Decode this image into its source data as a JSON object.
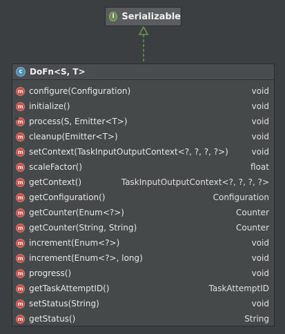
{
  "interface": {
    "badge": "I",
    "name": "Serializable"
  },
  "class": {
    "badge": "c",
    "name": "DoFn<S, T>",
    "members": [
      {
        "name": "configure(Configuration)",
        "type": "void",
        "abstract": false
      },
      {
        "name": "initialize()",
        "type": "void",
        "abstract": false
      },
      {
        "name": "process(S, Emitter<T>)",
        "type": "void",
        "abstract": true
      },
      {
        "name": "cleanup(Emitter<T>)",
        "type": "void",
        "abstract": false
      },
      {
        "name": "setContext(TaskInputOutputContext<?, ?, ?, ?>)",
        "type": "void",
        "abstract": false
      },
      {
        "name": "scaleFactor()",
        "type": "float",
        "abstract": false
      },
      {
        "name": "getContext()",
        "type": "TaskInputOutputContext<?, ?, ?, ?>",
        "abstract": false
      },
      {
        "name": "getConfiguration()",
        "type": "Configuration",
        "abstract": false
      },
      {
        "name": "getCounter(Enum<?>)",
        "type": "Counter",
        "abstract": false
      },
      {
        "name": "getCounter(String, String)",
        "type": "Counter",
        "abstract": false
      },
      {
        "name": "increment(Enum<?>)",
        "type": "void",
        "abstract": false
      },
      {
        "name": "increment(Enum<?>, long)",
        "type": "void",
        "abstract": false
      },
      {
        "name": "progress()",
        "type": "void",
        "abstract": false
      },
      {
        "name": "getTaskAttemptID()",
        "type": "TaskAttemptID",
        "abstract": false
      },
      {
        "name": "setStatus(String)",
        "type": "void",
        "abstract": false
      },
      {
        "name": "getStatus()",
        "type": "String",
        "abstract": false
      }
    ]
  },
  "member_badge": "m",
  "colors": {
    "background": "#3c3f41",
    "connector": "#6a9a4e",
    "method_badge": "#c2504a",
    "interface_badge": "#6a8d4e",
    "class_badge": "#4a8db0"
  }
}
